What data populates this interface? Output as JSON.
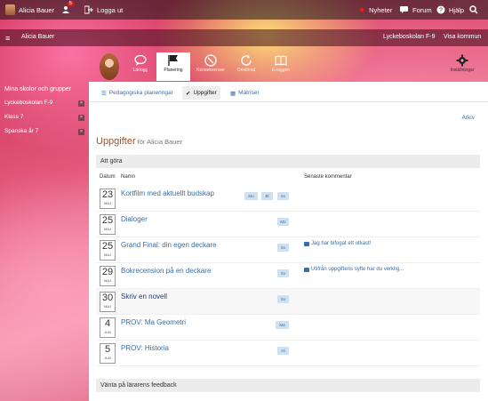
{
  "topbar": {
    "user": "Alicia Bauer",
    "notif_count": "5",
    "logout": "Logga ut",
    "news": "Nyheter",
    "forum": "Forum",
    "help": "Hjälp"
  },
  "secondbar": {
    "user": "Alicia Bauer",
    "school": "Lyckeboskolan F-9",
    "show_municipality": "Visa kommun"
  },
  "tabs": [
    {
      "label": "Lärlogg",
      "icon": "chat-icon"
    },
    {
      "label": "Planering",
      "icon": "flag-icon"
    },
    {
      "label": "Konsekvenser",
      "icon": "compass-icon"
    },
    {
      "label": "Omdömd",
      "icon": "refresh-icon"
    },
    {
      "label": "E-loggen",
      "icon": "book-icon"
    },
    {
      "label": "Inställningar",
      "icon": "gear-icon"
    }
  ],
  "sidebar": {
    "title": "Mina skolor och grupper",
    "items": [
      {
        "label": "Lyckeboskolan F-9"
      },
      {
        "label": "Klass 7"
      },
      {
        "label": "Spanska år 7"
      }
    ]
  },
  "subnav": {
    "planning": "Pedagogiska planeringar",
    "tasks": "Uppgifter",
    "matrices": "Matriser"
  },
  "archive": "Arkiv",
  "heading": {
    "title": "Uppgifter",
    "subtitle": "för Alicia Bauer"
  },
  "section_todo": "Att göra",
  "columns": {
    "date": "Datum",
    "name": "Namn",
    "latest": "Senaste kommentar"
  },
  "tasks": [
    {
      "day": "23",
      "month": "MAJ",
      "name": "Kortfilm med aktuellt budskap",
      "tags": [
        "Mu",
        "Bl",
        "Sv"
      ],
      "comment": ""
    },
    {
      "day": "25",
      "month": "MAJ",
      "name": "Dialoger",
      "tags": [
        "M2"
      ],
      "comment": ""
    },
    {
      "day": "25",
      "month": "MAJ",
      "name": "Grand Final: din egen deckare",
      "tags": [
        "Sv"
      ],
      "comment": "Jag har bifogat ett utkast!"
    },
    {
      "day": "29",
      "month": "MAJ",
      "name": "Bokrecension på en deckare",
      "tags": [
        "Sv"
      ],
      "comment": "Utifrån uppgiftens syfte har du verklig..."
    },
    {
      "day": "30",
      "month": "MAJ",
      "name": "Skriv en novell",
      "tags": [
        "Sv"
      ],
      "comment": ""
    },
    {
      "day": "4",
      "month": "JUN",
      "name": "PROV: Ma Geometri",
      "tags": [
        "Ma"
      ],
      "comment": ""
    },
    {
      "day": "5",
      "month": "JUN",
      "name": "PROV: Historia",
      "tags": [
        "Hi"
      ],
      "comment": ""
    }
  ],
  "section_feedback": "Vänta på lärarens feedback"
}
